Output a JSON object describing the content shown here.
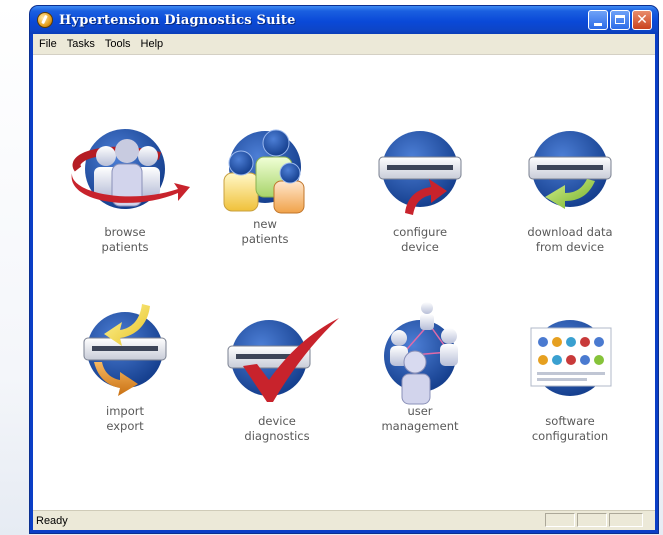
{
  "window": {
    "title": "Hypertension Diagnostics Suite"
  },
  "menu": [
    "File",
    "Tasks",
    "Tools",
    "Help"
  ],
  "tiles": [
    {
      "label": "browse\npatients",
      "icon": "browse-patients-icon"
    },
    {
      "label": "new\npatients",
      "icon": "new-patients-icon"
    },
    {
      "label": "configure\ndevice",
      "icon": "configure-device-icon"
    },
    {
      "label": "download data\nfrom device",
      "icon": "download-data-icon"
    },
    {
      "label": "import\nexport",
      "icon": "import-export-icon"
    },
    {
      "label": "device\ndiagnostics",
      "icon": "device-diagnostics-icon"
    },
    {
      "label": "user\nmanagement",
      "icon": "user-management-icon"
    },
    {
      "label": "software\nconfiguration",
      "icon": "software-configuration-icon"
    }
  ],
  "status": {
    "text": "Ready"
  },
  "colors": {
    "circle_blue": "#1f4fae",
    "arrow_red": "#c8232c",
    "arrow_yellow": "#f2d33a",
    "arrow_green": "#86c33a",
    "arrow_orange": "#e08a1e"
  }
}
